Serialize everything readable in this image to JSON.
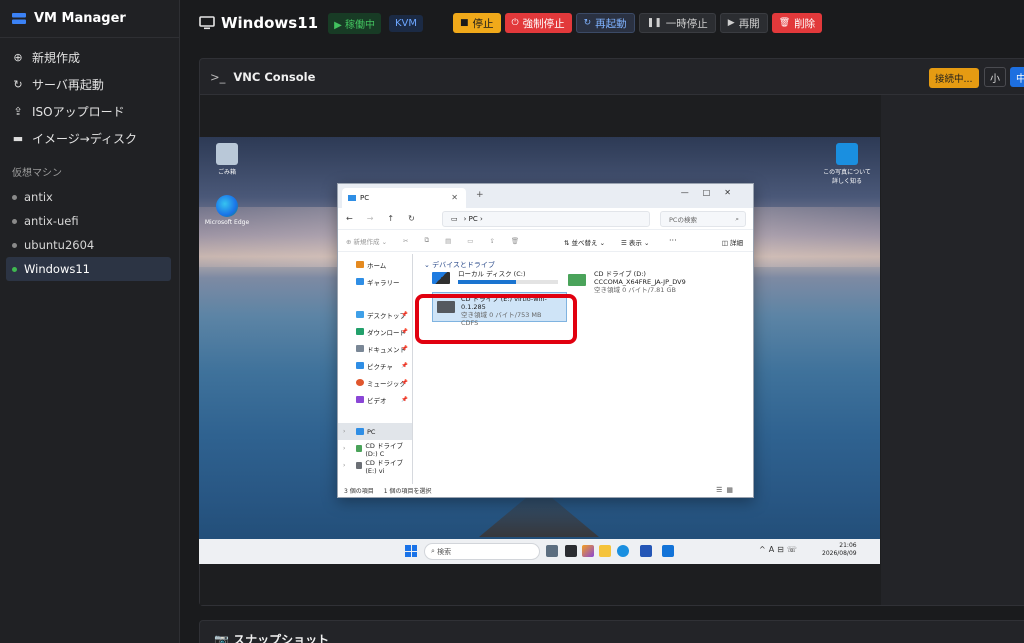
{
  "app": {
    "title": "VM Manager"
  },
  "sidebar": {
    "menu": [
      {
        "icon": "plus-circle-icon",
        "label": "新規作成"
      },
      {
        "icon": "refresh-icon",
        "label": "サーバ再起動"
      },
      {
        "icon": "upload-icon",
        "label": "ISOアップロード"
      },
      {
        "icon": "disk-icon",
        "label": "イメージ→ディスク"
      }
    ],
    "section_label": "仮想マシン",
    "vms": [
      {
        "label": "antix",
        "active": false
      },
      {
        "label": "antix-uefi",
        "active": false
      },
      {
        "label": "ubuntu2604",
        "active": false
      },
      {
        "label": "Windows11",
        "active": true
      }
    ]
  },
  "header": {
    "title": "Windows11",
    "status": "稼働中",
    "hypervisor": "KVM",
    "buttons": {
      "stop": "停止",
      "force_stop": "強制停止",
      "reboot": "再起動",
      "pause": "一時停止",
      "resume": "再開",
      "delete": "削除"
    }
  },
  "vnc": {
    "title": "VNC Console",
    "connection": "接続中...",
    "size_small": "小",
    "size_medium": "中"
  },
  "snapshots": {
    "title": "スナップショット"
  },
  "guest": {
    "desktop_icons": {
      "recycle_bin": "ごみ箱",
      "edge": "Microsoft Edge",
      "photo": "この写真について詳しく知る"
    },
    "explorer": {
      "tab_title": "PC",
      "address": "PC",
      "search_placeholder": "PCの検索",
      "commands": {
        "new": "新規作成",
        "sort": "並べ替え",
        "view": "表示",
        "details": "詳細"
      },
      "nav": {
        "home": "ホーム",
        "gallery": "ギャラリー",
        "desktop": "デスクトップ",
        "downloads": "ダウンロード",
        "documents": "ドキュメント",
        "pictures": "ピクチャ",
        "music": "ミュージック",
        "videos": "ビデオ",
        "pc": "PC",
        "cd_d": "CD ドライブ (D:) C",
        "cd_e": "CD ドライブ (E:) vi"
      },
      "section_title": "デバイスとドライブ",
      "drives": {
        "c_name": "ローカル ディスク (C:)",
        "c_used_fraction": 0.58,
        "d_name": "CD ドライブ (D:)",
        "d_label": "CCCOMA_X64FRE_JA-JP_DV9",
        "d_free": "空き領域 0 バイト/7.81 GB",
        "e_name": "CD ドライブ (E:) virtio-win-0.1.285",
        "e_free": "空き領域 0 バイト/753 MB",
        "e_fs": "CDFS"
      },
      "status": {
        "items": "3 個の項目",
        "selected": "1 個の項目を選択"
      }
    },
    "taskbar": {
      "search": "検索",
      "time": "21:06",
      "date": "2026/08/09"
    }
  },
  "colors": {
    "accent": "#1d6fe0",
    "running": "#42c25f",
    "warning": "#f0a91a",
    "danger": "#e2393b",
    "highlight": "#e1000f"
  }
}
